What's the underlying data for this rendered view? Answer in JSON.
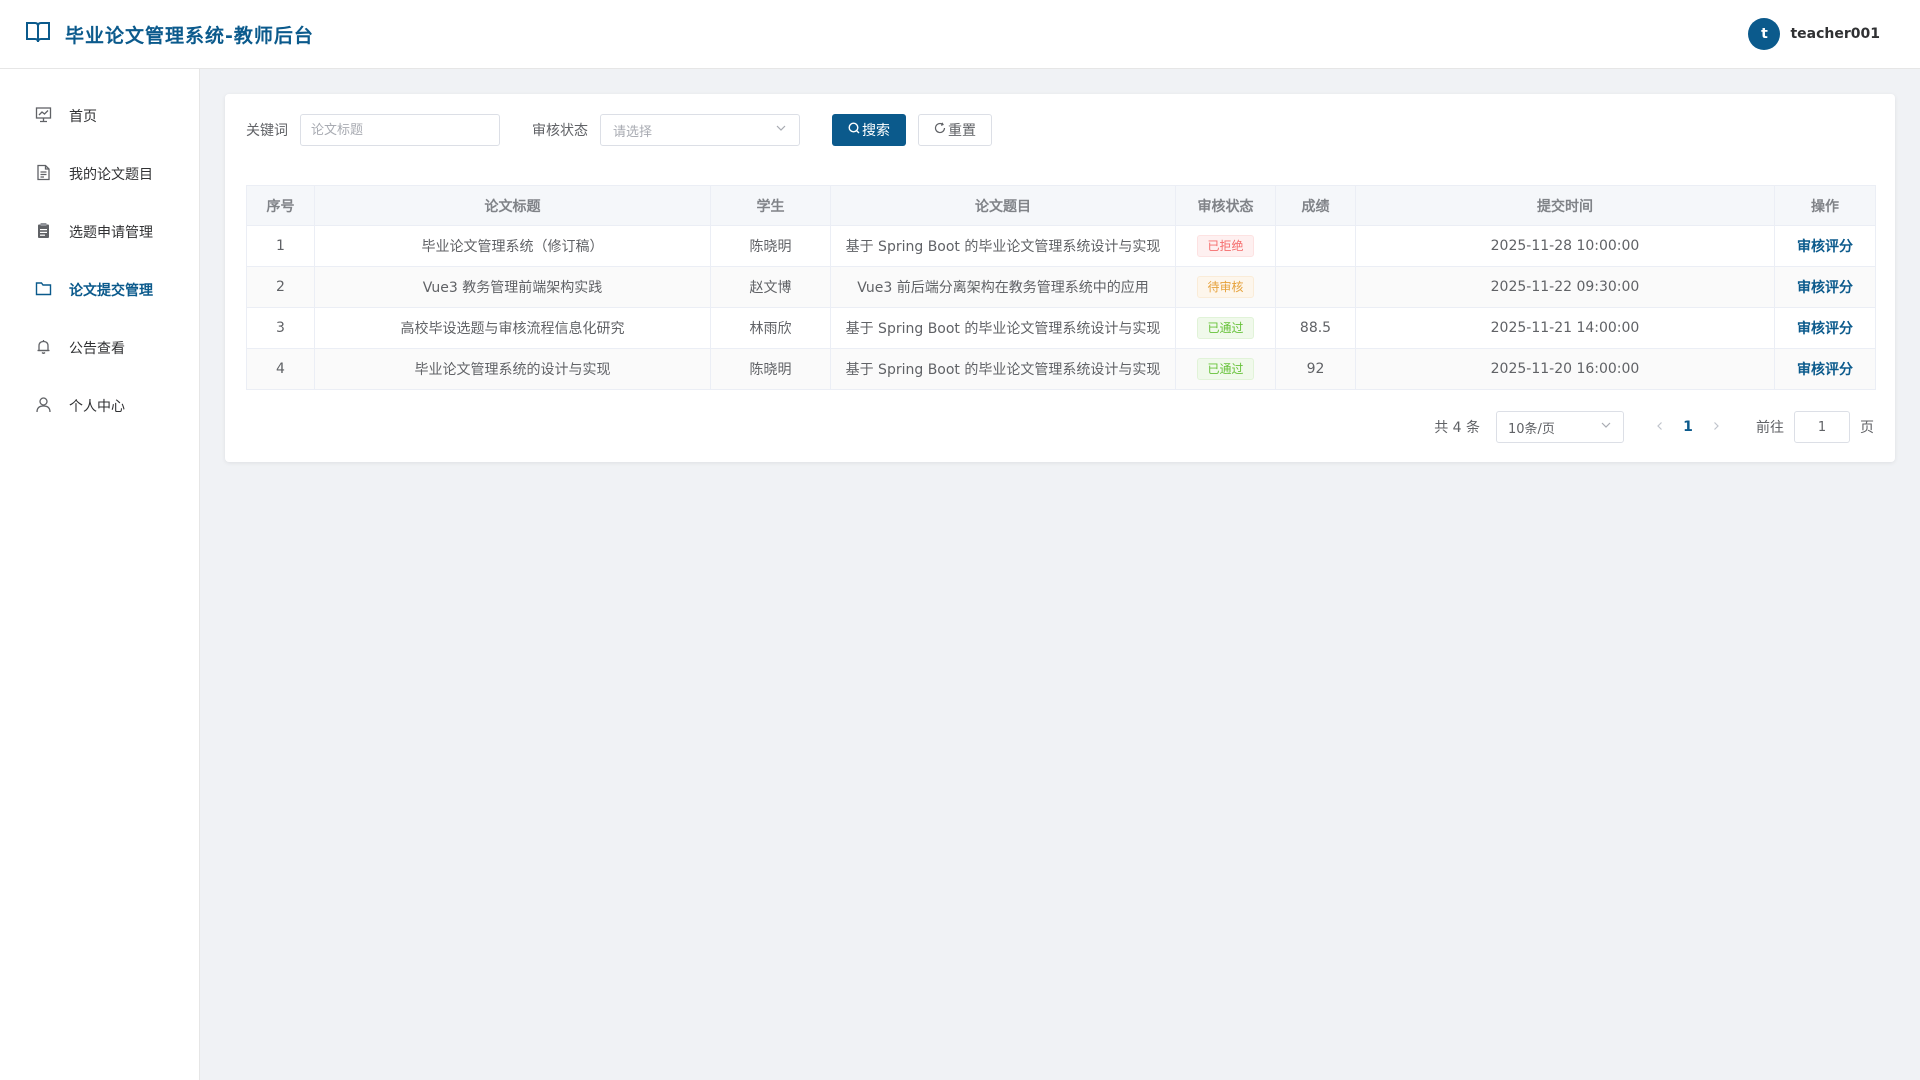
{
  "header": {
    "title": "毕业论文管理系统-教师后台",
    "avatar_letter": "t",
    "username": "teacher001"
  },
  "sidebar": {
    "items": [
      {
        "label": "首页",
        "icon": "dashboard-icon"
      },
      {
        "label": "我的论文题目",
        "icon": "document-icon"
      },
      {
        "label": "选题申请管理",
        "icon": "clipboard-icon"
      },
      {
        "label": "论文提交管理",
        "icon": "folder-icon",
        "active": true
      },
      {
        "label": "公告查看",
        "icon": "bell-icon"
      },
      {
        "label": "个人中心",
        "icon": "user-icon"
      }
    ]
  },
  "filter": {
    "keyword_label": "关键词",
    "keyword_placeholder": "论文标题",
    "status_label": "审核状态",
    "status_placeholder": "请选择",
    "search_label": "搜索",
    "reset_label": "重置"
  },
  "table": {
    "columns": [
      "序号",
      "论文标题",
      "学生",
      "论文题目",
      "审核状态",
      "成绩",
      "提交时间",
      "操作"
    ],
    "rows": [
      {
        "index": "1",
        "title": "毕业论文管理系统（修订稿）",
        "student": "陈晓明",
        "topic": "基于 Spring Boot 的毕业论文管理系统设计与实现",
        "status": "已拒绝",
        "status_type": "danger",
        "score": "",
        "time": "2025-11-28 10:00:00",
        "action": "审核评分"
      },
      {
        "index": "2",
        "title": "Vue3 教务管理前端架构实践",
        "student": "赵文博",
        "topic": "Vue3 前后端分离架构在教务管理系统中的应用",
        "status": "待审核",
        "status_type": "warning",
        "score": "",
        "time": "2025-11-22 09:30:00",
        "action": "审核评分"
      },
      {
        "index": "3",
        "title": "高校毕设选题与审核流程信息化研究",
        "student": "林雨欣",
        "topic": "基于 Spring Boot 的毕业论文管理系统设计与实现",
        "status": "已通过",
        "status_type": "success",
        "score": "88.5",
        "time": "2025-11-21 14:00:00",
        "action": "审核评分"
      },
      {
        "index": "4",
        "title": "毕业论文管理系统的设计与实现",
        "student": "陈晓明",
        "topic": "基于 Spring Boot 的毕业论文管理系统设计与实现",
        "status": "已通过",
        "status_type": "success",
        "score": "92",
        "time": "2025-11-20 16:00:00",
        "action": "审核评分"
      }
    ]
  },
  "status_colors": {
    "danger": {
      "text": "#f56c6c",
      "bg": "#fef0f0",
      "border": "#fde2e2"
    },
    "warning": {
      "text": "#e6a23c",
      "bg": "#fdf6ec",
      "border": "#faecd8"
    },
    "success": {
      "text": "#67c23a",
      "bg": "#f0f9eb",
      "border": "#e1f3d8"
    }
  },
  "pagination": {
    "total_text": "共 4 条",
    "page_size": "10条/页",
    "current_page": "1",
    "goto_label": "前往",
    "goto_value": "1",
    "page_suffix": "页"
  },
  "colors": {
    "primary": "#0b5a8c"
  }
}
